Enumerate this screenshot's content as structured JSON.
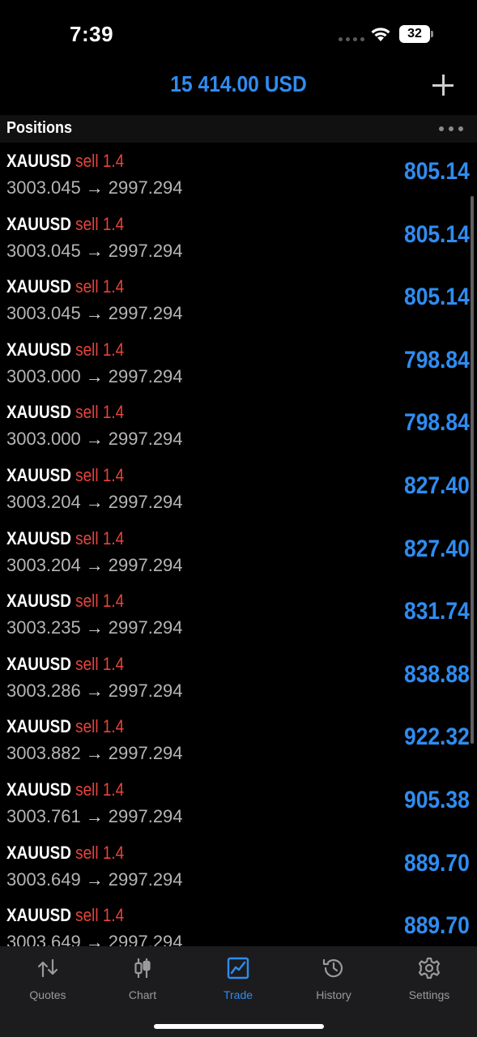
{
  "status_bar": {
    "time": "7:39",
    "battery_level": "32"
  },
  "header": {
    "balance": "15 414.00 USD",
    "add_icon": "plus-icon"
  },
  "section": {
    "title": "Positions",
    "more_icon": "ellipsis-icon"
  },
  "positions": [
    {
      "symbol": "XAUUSD",
      "side": "sell",
      "volume": "1.4",
      "open_price": "3003.045",
      "arrow": "→",
      "current_price": "2997.294",
      "profit": "805.14"
    },
    {
      "symbol": "XAUUSD",
      "side": "sell",
      "volume": "1.4",
      "open_price": "3003.045",
      "arrow": "→",
      "current_price": "2997.294",
      "profit": "805.14"
    },
    {
      "symbol": "XAUUSD",
      "side": "sell",
      "volume": "1.4",
      "open_price": "3003.045",
      "arrow": "→",
      "current_price": "2997.294",
      "profit": "805.14"
    },
    {
      "symbol": "XAUUSD",
      "side": "sell",
      "volume": "1.4",
      "open_price": "3003.000",
      "arrow": "→",
      "current_price": "2997.294",
      "profit": "798.84"
    },
    {
      "symbol": "XAUUSD",
      "side": "sell",
      "volume": "1.4",
      "open_price": "3003.000",
      "arrow": "→",
      "current_price": "2997.294",
      "profit": "798.84"
    },
    {
      "symbol": "XAUUSD",
      "side": "sell",
      "volume": "1.4",
      "open_price": "3003.204",
      "arrow": "→",
      "current_price": "2997.294",
      "profit": "827.40"
    },
    {
      "symbol": "XAUUSD",
      "side": "sell",
      "volume": "1.4",
      "open_price": "3003.204",
      "arrow": "→",
      "current_price": "2997.294",
      "profit": "827.40"
    },
    {
      "symbol": "XAUUSD",
      "side": "sell",
      "volume": "1.4",
      "open_price": "3003.235",
      "arrow": "→",
      "current_price": "2997.294",
      "profit": "831.74"
    },
    {
      "symbol": "XAUUSD",
      "side": "sell",
      "volume": "1.4",
      "open_price": "3003.286",
      "arrow": "→",
      "current_price": "2997.294",
      "profit": "838.88"
    },
    {
      "symbol": "XAUUSD",
      "side": "sell",
      "volume": "1.4",
      "open_price": "3003.882",
      "arrow": "→",
      "current_price": "2997.294",
      "profit": "922.32"
    },
    {
      "symbol": "XAUUSD",
      "side": "sell",
      "volume": "1.4",
      "open_price": "3003.761",
      "arrow": "→",
      "current_price": "2997.294",
      "profit": "905.38"
    },
    {
      "symbol": "XAUUSD",
      "side": "sell",
      "volume": "1.4",
      "open_price": "3003.649",
      "arrow": "→",
      "current_price": "2997.294",
      "profit": "889.70"
    },
    {
      "symbol": "XAUUSD",
      "side": "sell",
      "volume": "1.4",
      "open_price": "3003.649",
      "arrow": "→",
      "current_price": "2997.294",
      "profit": "889.70"
    }
  ],
  "tabs": [
    {
      "label": "Quotes",
      "icon": "quotes-arrows-icon",
      "active": false
    },
    {
      "label": "Chart",
      "icon": "candlestick-icon",
      "active": false
    },
    {
      "label": "Trade",
      "icon": "trade-chart-icon",
      "active": true
    },
    {
      "label": "History",
      "icon": "history-clock-icon",
      "active": false
    },
    {
      "label": "Settings",
      "icon": "gear-icon",
      "active": false
    }
  ],
  "colors": {
    "accent": "#2f8cf0",
    "sell": "#e8443c",
    "background": "#000000",
    "tab_bar": "#1c1c1e"
  }
}
